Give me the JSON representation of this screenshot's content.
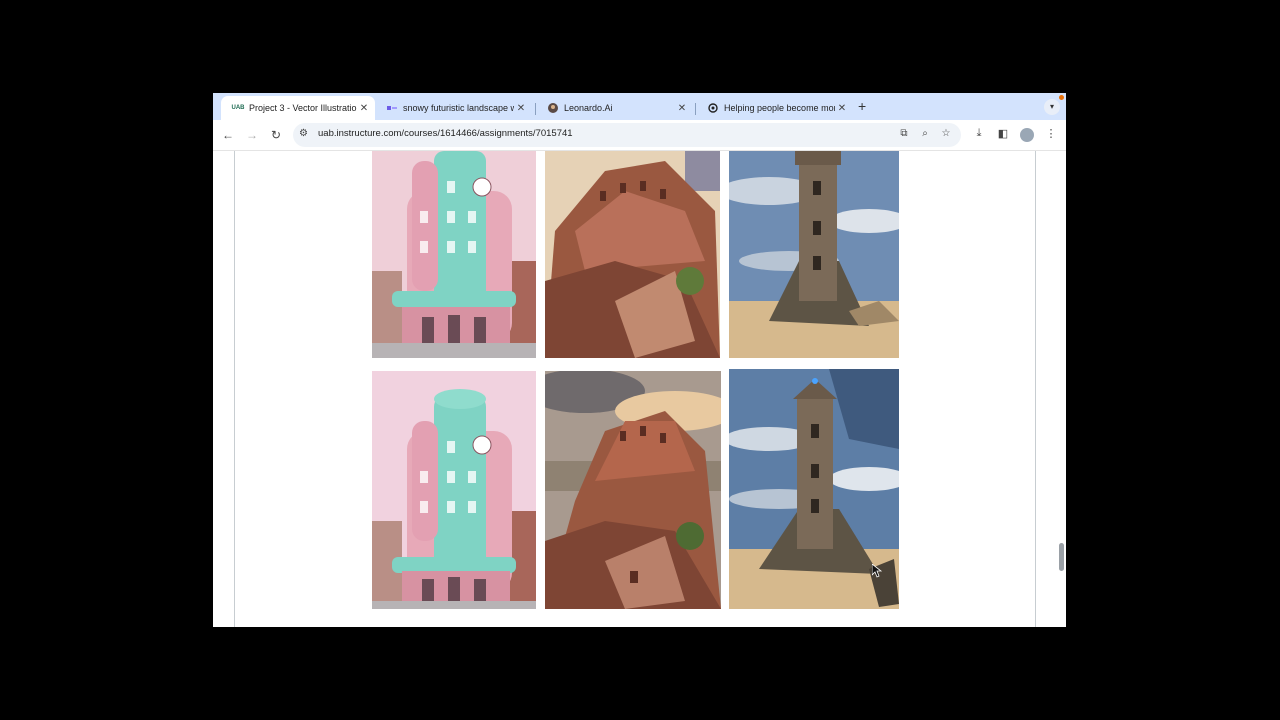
{
  "tabs": [
    {
      "title": "Project 3 - Vector Illustration",
      "favicon": "uab-logo-icon",
      "active": true
    },
    {
      "title": "snowy futuristic landscape w",
      "favicon": "leonardo-gen-icon",
      "active": false
    },
    {
      "title": "Leonardo.Ai",
      "favicon": "leonardo-icon",
      "active": false
    },
    {
      "title": "Helping people become more",
      "favicon": "openai-icon",
      "active": false
    }
  ],
  "toolbar": {
    "url": "uab.instructure.com/courses/1614466/assignments/7015741"
  },
  "gallery": {
    "images": [
      {
        "subject": "pink and teal round tower building",
        "icon": "pink-teal-building-image"
      },
      {
        "subject": "red sandstone palace on cliffs",
        "icon": "sandstone-palace-image"
      },
      {
        "subject": "stone tower on rocky outcrop",
        "icon": "rock-tower-image"
      },
      {
        "subject": "pink and teal round tower building",
        "icon": "pink-teal-building-image"
      },
      {
        "subject": "red sandstone palace at sunset",
        "icon": "sandstone-palace-image"
      },
      {
        "subject": "stone tower with blue beacon",
        "icon": "rock-tower-image"
      }
    ]
  },
  "colors": {
    "tabstrip": "#d3e3fd",
    "omnibox": "#eff3f8",
    "pink_building": "#e7a9b8",
    "teal_accent": "#7fd3c4",
    "sandstone": "#9a5840",
    "sky_blue": "#6f8db3"
  }
}
